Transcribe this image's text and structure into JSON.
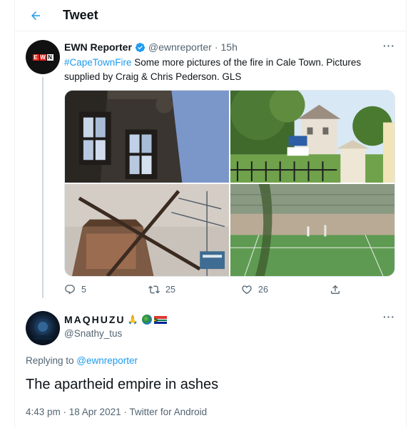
{
  "header": {
    "title": "Tweet",
    "back_icon": "arrow-left-icon"
  },
  "colors": {
    "accent": "#1d9bf0",
    "text": "#0f1419",
    "muted": "#536471",
    "border": "#eff3f4"
  },
  "tweet1": {
    "display_name": "EWN Reporter",
    "verified_icon": "verified-badge-icon",
    "handle": "@ewnreporter",
    "separator": "·",
    "time": "15h",
    "more_label": "···",
    "hashtag": "#CapeTownFire",
    "text_line1": " Some more pictures of the fire in Cale Town. Pictures",
    "text_line2": "supplied by Craig & Chris Pederson. GLS",
    "media": [
      {
        "description_icon": "photo-building-windows"
      },
      {
        "description_icon": "photo-street-fence"
      },
      {
        "description_icon": "photo-burnt-windmill"
      },
      {
        "description_icon": "photo-sports-field-smoke"
      }
    ],
    "actions": {
      "reply_count": "5",
      "retweet_count": "25",
      "like_count": "26"
    }
  },
  "tweet2": {
    "display_name": "MAQHUZU",
    "emoji_pray": "🙏",
    "handle": "@Snathy_tus",
    "more_label": "···",
    "replying_prefix": "Replying to ",
    "replying_handle": "@ewnreporter",
    "text": "The apartheid empire in ashes",
    "meta": "4:43 pm · 18 Apr 2021 · Twitter for Android"
  }
}
